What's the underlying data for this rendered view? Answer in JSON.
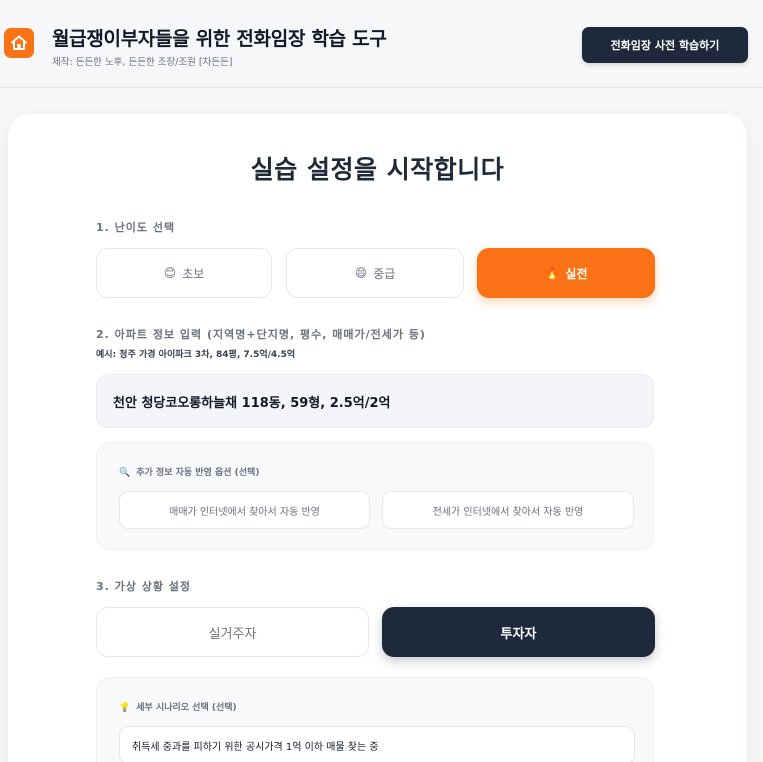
{
  "header": {
    "title": "월급쟁이부자들을 위한 전화임장 학습 도구",
    "subtitle": "제작: 든든한 노후, 든든한 조장/조원 [차든든]",
    "prelearn_button": "전화임장 사전 학습하기",
    "logo_icon": "house-icon",
    "accent_color": "#f97316"
  },
  "setup": {
    "title": "실습 설정을 시작합니다",
    "difficulty": {
      "label": "1. 난이도 선택",
      "options": [
        {
          "emoji": "😊",
          "label": "초보"
        },
        {
          "emoji": "😄",
          "label": "중급"
        },
        {
          "emoji": "🔥",
          "label": "실전"
        }
      ],
      "selected": "실전"
    },
    "apartment": {
      "label": "2. 아파트 정보 입력 (지역명+단지명, 평수, 매매가/전세가 등)",
      "hint": "예시: 청주 가경 아이파크 3차, 84평, 7.5억/4.5억",
      "value": "천안 청당코오롱하늘채 118동, 59형, 2.5억/2억"
    },
    "auto_options": {
      "icon": "magnifier-icon",
      "label": "추가 정보 자동 반영 옵션 (선택)",
      "sale_button": "매매가 인터넷에서 찾아서 자동 반영",
      "jeonse_button": "전세가 인터넷에서 찾아서 자동 반영"
    },
    "situation": {
      "label": "3. 가상 상황 설정",
      "options": [
        "실거주자",
        "투자자"
      ],
      "selected": "투자자"
    },
    "scenario": {
      "icon": "lightbulb-icon",
      "label": "세부 시나리오 선택 (선택)",
      "value": "취득세 중과를 피하기 위한 공시가격 1억 이하 매물 찾는 중"
    }
  }
}
